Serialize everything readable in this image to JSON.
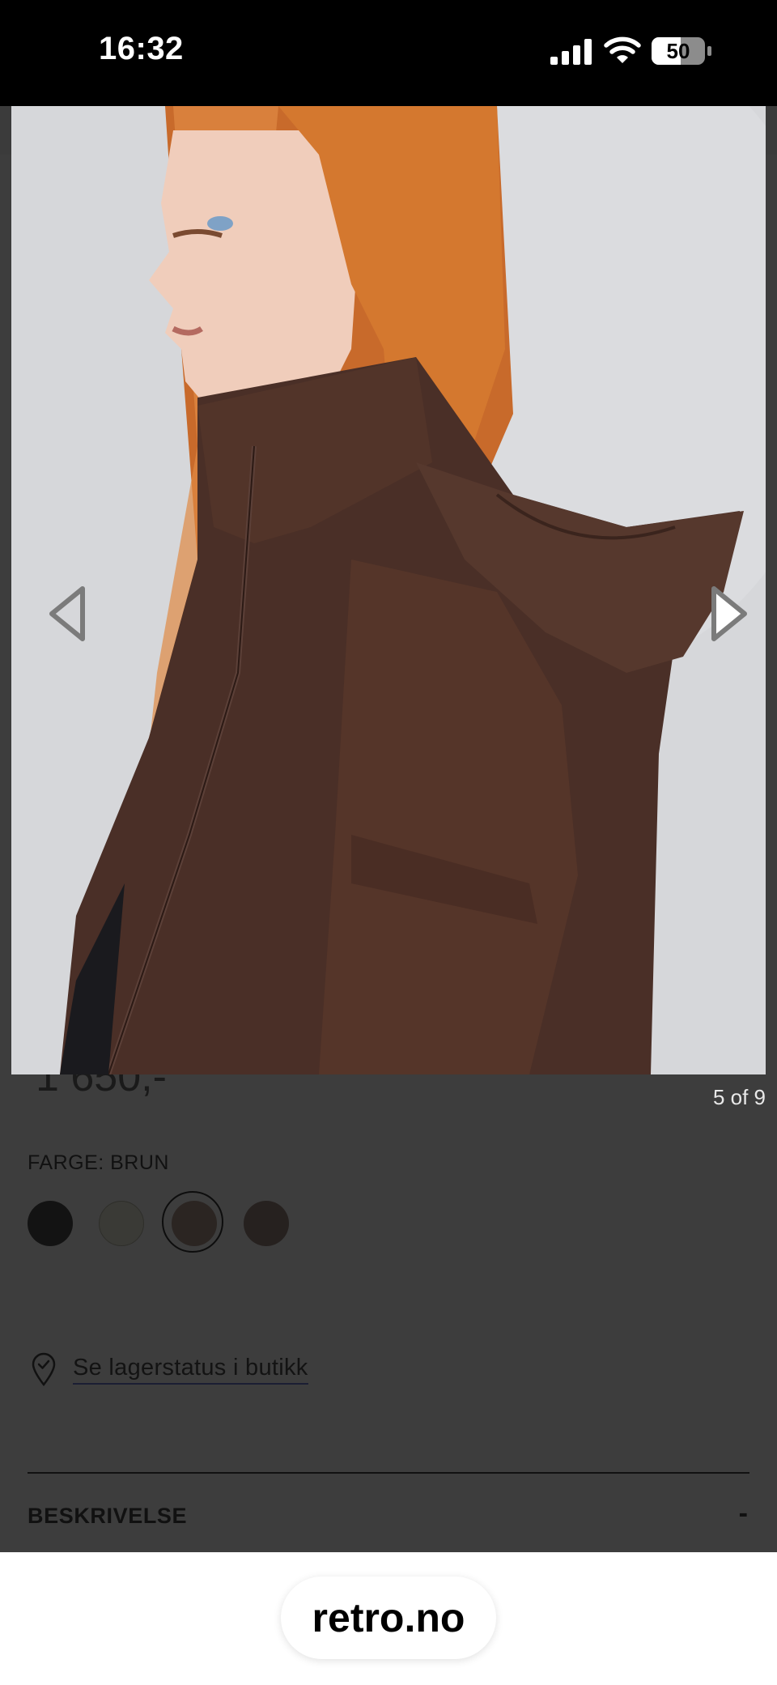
{
  "status_bar": {
    "time": "16:32",
    "battery": "50",
    "icons": [
      "signal-icon",
      "wifi-icon",
      "battery-icon"
    ]
  },
  "product": {
    "price_partial": "1 650,-",
    "image_counter": "5 of 9",
    "color_label": "FARGE: BRUN",
    "swatches": [
      {
        "name": "black",
        "color": "#131313"
      },
      {
        "name": "olive",
        "color": "#3a3a36"
      },
      {
        "name": "brown",
        "color": "#2b2522",
        "selected": true
      },
      {
        "name": "dark-brown",
        "color": "#26211f"
      }
    ]
  },
  "store": {
    "link_label": "Se lagerstatus i butikk",
    "icon": "location-check-icon"
  },
  "description": {
    "heading": "BESKRIVELSE",
    "toggle": "-"
  },
  "browser": {
    "url": "retro.no"
  },
  "colors": {
    "overlay": "#3d3d3d",
    "jacket": "#4a2f27",
    "hair": "#d47a35"
  }
}
